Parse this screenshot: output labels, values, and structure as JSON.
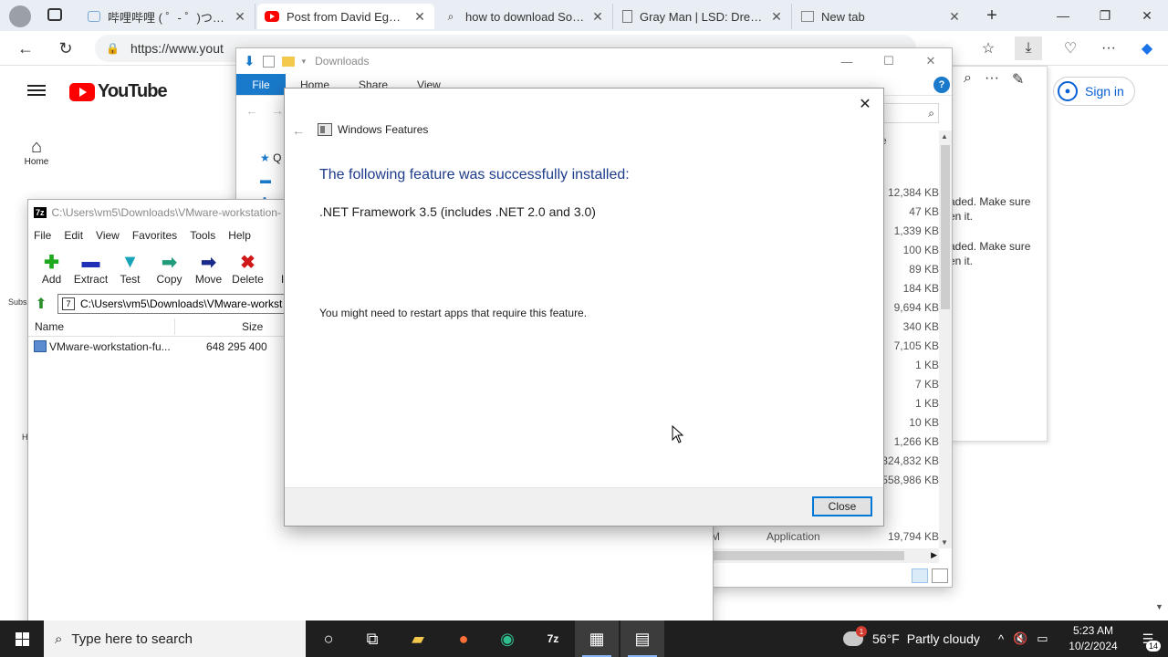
{
  "browser": {
    "tabs": [
      {
        "label": "哔哩哔哩 ( ゜- ゜)つロ 干杯~",
        "icon": "bilibili-icon"
      },
      {
        "label": "Post from David Egan - Y",
        "icon": "youtube-icon"
      },
      {
        "label": "how to download Sogou",
        "icon": "search-icon"
      },
      {
        "label": "Gray Man | LSD: Dream E",
        "icon": "page-icon"
      },
      {
        "label": "New tab",
        "icon": "newtab-icon"
      }
    ],
    "url": "https://www.yout",
    "controls": {
      "minimize": "—",
      "restore": "❐",
      "close": "✕",
      "new_tab": "+"
    }
  },
  "youtube": {
    "logo_text": "YouTube",
    "home_label": "Home",
    "subscriptions_fragment": "Subs",
    "history_fragment": "H",
    "signin_label": "Sign in",
    "notifications": [
      {
        "line1": "aded. Make sure",
        "line2": "en it."
      },
      {
        "line1": "aded. Make sure",
        "line2": "en it."
      }
    ]
  },
  "explorer": {
    "title": "Downloads",
    "ribbon_tabs": {
      "file": "File",
      "home": "Home",
      "share": "Share",
      "view": "View"
    },
    "help": "?",
    "size_header": "ze",
    "sizes": [
      "12,384 KB",
      "47 KB",
      "1,339 KB",
      "100 KB",
      "89 KB",
      "184 KB",
      "9,694 KB",
      "340 KB",
      "7,105 KB",
      "1 KB",
      "7 KB",
      "1 KB",
      "10 KB",
      "1,266 KB",
      "324,832 KB",
      "558,986 KB"
    ],
    "last_row": {
      "time_fragment": "M",
      "type": "Application",
      "size": "19,794 KB"
    },
    "left_fragment": "Q"
  },
  "sevenzip": {
    "title": "C:\\Users\\vm5\\Downloads\\VMware-workstation-",
    "logo": "7z",
    "menu": [
      "File",
      "Edit",
      "View",
      "Favorites",
      "Tools",
      "Help"
    ],
    "toolbar": [
      {
        "label": "Add",
        "icon": "add-icon",
        "glyph": "✚",
        "color": "#1ea81e"
      },
      {
        "label": "Extract",
        "icon": "extract-icon",
        "glyph": "▬",
        "color": "#1f2fb8"
      },
      {
        "label": "Test",
        "icon": "test-icon",
        "glyph": "▼",
        "color": "#19a3b8"
      },
      {
        "label": "Copy",
        "icon": "copy-icon",
        "glyph": "➡",
        "color": "#1f9a7a"
      },
      {
        "label": "Move",
        "icon": "move-icon",
        "glyph": "➡",
        "color": "#1a2a8a"
      },
      {
        "label": "Delete",
        "icon": "delete-icon",
        "glyph": "✖",
        "color": "#d01818"
      },
      {
        "label": "Inf",
        "icon": "info-icon",
        "glyph": "i",
        "color": "#c8a000"
      }
    ],
    "path": "C:\\Users\\vm5\\Downloads\\VMware-workst",
    "columns": {
      "name": "Name",
      "size": "Size"
    },
    "rows": [
      {
        "name": "VMware-workstation-fu...",
        "size": "648 295 400"
      }
    ]
  },
  "dialog": {
    "title": "Windows Features",
    "heading": "The following feature was successfully installed:",
    "feature": ".NET Framework 3.5 (includes .NET 2.0 and 3.0)",
    "note": "You might need to restart apps that require this feature.",
    "close_button": "Close",
    "heading_color": "#1e3c8c"
  },
  "taskbar": {
    "search_placeholder": "Type here to search",
    "weather": {
      "temp": "56°F",
      "condition": "Partly cloudy"
    },
    "clock": {
      "time": "5:23 AM",
      "date": "10/2/2024"
    },
    "notification_count": "14"
  }
}
